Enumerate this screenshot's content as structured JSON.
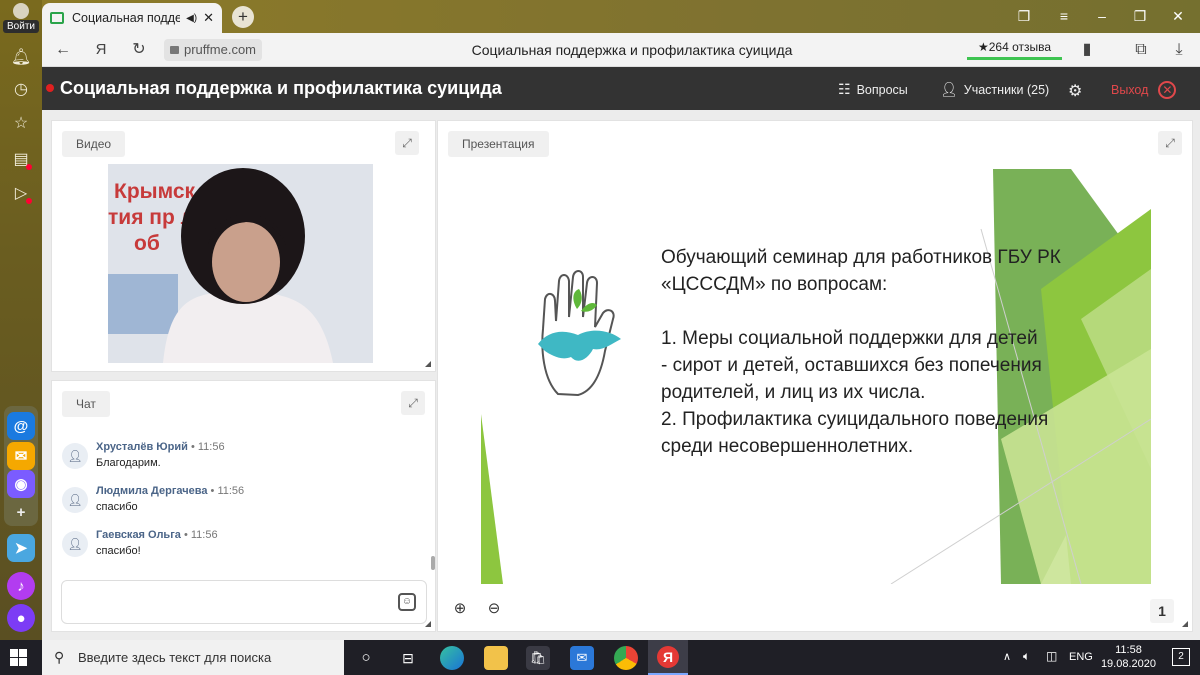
{
  "browser": {
    "login_label": "Войти",
    "tab": {
      "title": "Социальная поддер"
    },
    "url": "pruffme.com",
    "page_title": "Социальная поддержка и профилактика суицида",
    "rating": "★264 отзыва",
    "yandex_letter": "Я"
  },
  "header": {
    "title": "Социальная поддержка и профилактика суицида",
    "questions_label": "Вопросы",
    "participants_label": "Участники (25)",
    "exit_label": "Выход"
  },
  "video": {
    "tab_label": "Видео"
  },
  "chat": {
    "tab_label": "Чат",
    "messages": [
      {
        "name": "Хрусталёв Юрий",
        "time": "• 11:56",
        "text": "Благодарим."
      },
      {
        "name": "Людмила Дергачева",
        "time": "• 11:56",
        "text": "спасибо"
      },
      {
        "name": "Гаевская Ольга",
        "time": "• 11:56",
        "text": "спасибо!"
      }
    ]
  },
  "presentation": {
    "tab_label": "Презентация",
    "page_number": "1",
    "slide_lines": [
      "Обучающий семинар для работников ГБУ РК",
      "«ЦСССДМ» по вопросам:",
      "",
      "1.      Меры социальной поддержки для детей",
      "- сирот и детей, оставшихся без попечения",
      "родителей, и лиц из их числа.",
      "2.      Профилактика суицидального поведения",
      "среди несовершеннолетних."
    ],
    "video_backdrop_text": [
      "Крымск    нтр",
      "тия пр     льного",
      "об"
    ]
  },
  "taskbar": {
    "search_placeholder": "Введите здесь текст для поиска",
    "lang": "ENG",
    "time": "11:58",
    "date": "19.08.2020",
    "notifications": "2"
  },
  "colors": {
    "header_bg": "#333333",
    "exit": "#e0484b",
    "slide_green": "#8dc63f",
    "rating_underline": "#3ec451"
  }
}
